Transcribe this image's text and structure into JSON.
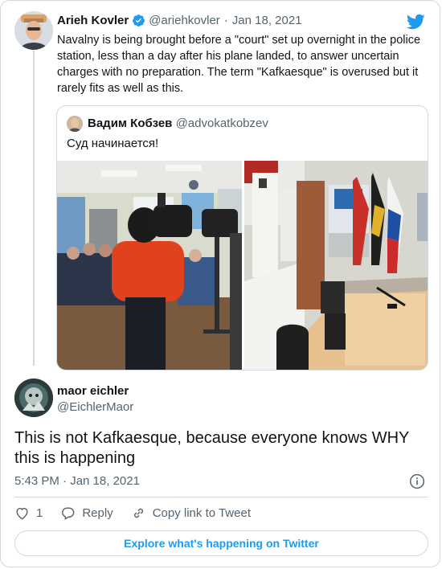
{
  "colors": {
    "accent": "#1d9bf0",
    "text": "#0f1419",
    "muted": "#536471",
    "border": "#cfd9de"
  },
  "tweet": {
    "author_name": "Arieh Kovler",
    "handle": "@ariehkovler",
    "separator": "·",
    "date": "Jan 18, 2021",
    "text": "Navalny is being brought before a \"court\" set up overnight in the police station, less than a day after his plane landed, to answer uncertain charges with no preparation. The term  \"Kafkaesque\" is overused but it rarely fits as well as this."
  },
  "quoted": {
    "author_name": "Вадим Кобзев",
    "handle": "@advokatkobzev",
    "text": "Суд начинается!",
    "photos": [
      {
        "icon": "courtroom-camera-crew-photo"
      },
      {
        "icon": "courtroom-table-flags-photo"
      }
    ]
  },
  "reply": {
    "author_name": "maor eichler",
    "handle": "@EichlerMaor",
    "text": "This is not Kafkaesque, because everyone knows WHY this is happening",
    "timestamp": "5:43 PM · Jan 18, 2021"
  },
  "actions": {
    "like_count": "1",
    "reply_label": "Reply",
    "copy_label": "Copy link to Tweet"
  },
  "explore_label": "Explore what's happening on Twitter"
}
